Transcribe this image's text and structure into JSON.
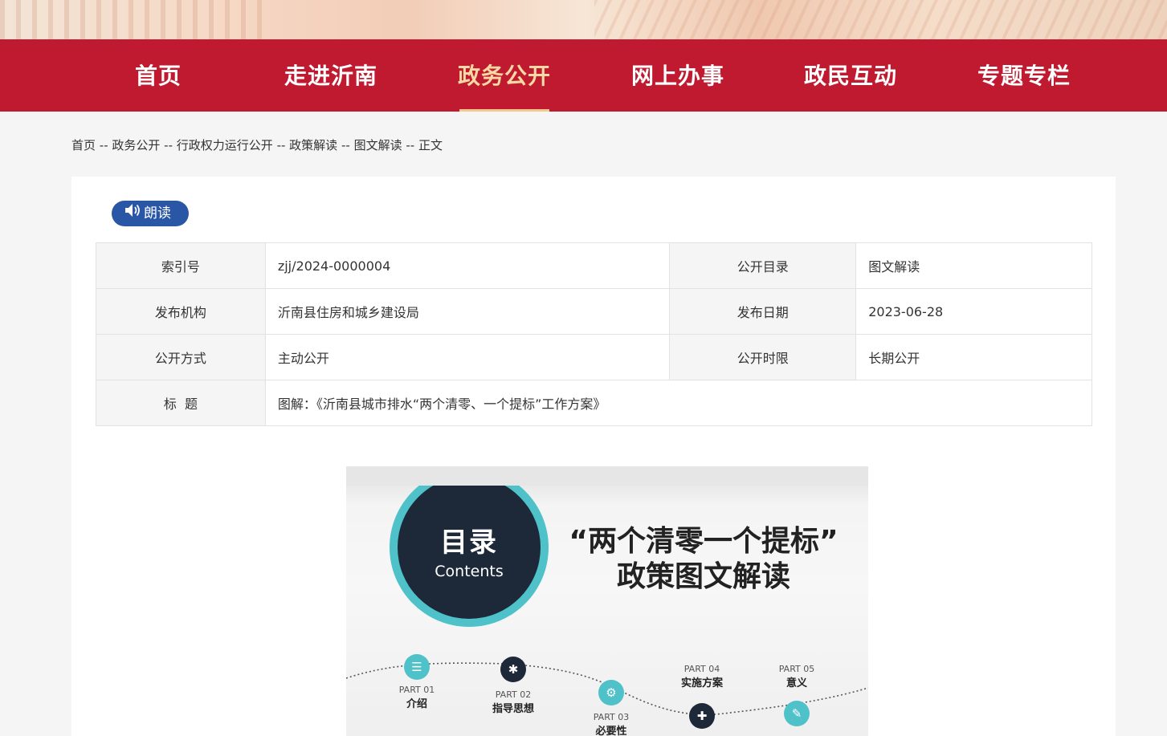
{
  "nav": {
    "items": [
      {
        "label": "首页"
      },
      {
        "label": "走进沂南"
      },
      {
        "label": "政务公开",
        "active": true
      },
      {
        "label": "网上办事"
      },
      {
        "label": "政民互动"
      },
      {
        "label": "专题专栏"
      }
    ]
  },
  "breadcrumb": {
    "items": [
      "首页",
      "政务公开",
      "行政权力运行公开",
      "政策解读",
      "图文解读",
      "正文"
    ],
    "separator": " -- "
  },
  "read_button": {
    "label": "朗读",
    "icon": "speaker-icon"
  },
  "meta_table": {
    "index_label": "索引号",
    "index_value": "zjj/2024-0000004",
    "catalog_label": "公开目录",
    "catalog_value": "图文解读",
    "publisher_label": "发布机构",
    "publisher_value": "沂南县住房和城乡建设局",
    "date_label": "发布日期",
    "date_value": "2023-06-28",
    "mode_label": "公开方式",
    "mode_value": "主动公开",
    "term_label": "公开时限",
    "term_value": "长期公开",
    "title_label": "标  题",
    "title_value": "图解：《沂南县城市排水“两个清零、一个提标”工作方案》"
  },
  "poster": {
    "circle_title": "目录",
    "circle_subtitle": "Contents",
    "headline_line1": "“两个清零一个提标”",
    "headline_line2": "政策图文解读",
    "parts": [
      {
        "label": "PART 01",
        "name": "介绍",
        "icon": "list-icon"
      },
      {
        "label": "PART 02",
        "name": "指导思想",
        "icon": "lightbulb-icon"
      },
      {
        "label": "PART 03",
        "name": "必要性",
        "icon": "gears-icon"
      },
      {
        "label": "PART 04",
        "name": "实施方案",
        "icon": "signpost-icon"
      },
      {
        "label": "PART 05",
        "name": "意义",
        "icon": "pen-icon"
      }
    ]
  },
  "colors": {
    "nav_bg": "#bf1a2f",
    "nav_active": "#f8d8a4",
    "button_blue": "#2a56a6",
    "teal": "#4fc1c9",
    "navy": "#1d2939"
  }
}
